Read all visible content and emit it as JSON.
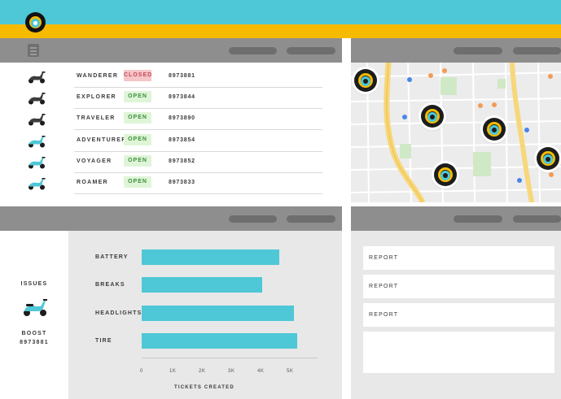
{
  "colors": {
    "brand_teal": "#4ec7d6",
    "brand_yellow": "#f6bb00",
    "open_bg": "#dff5d8",
    "closed_bg": "#f6c5c8"
  },
  "header": {
    "logo_icon": "logo-icon"
  },
  "fleet": {
    "rows": [
      {
        "name": "WANDERER",
        "status": "CLOSED",
        "status_type": "closed",
        "id": "8973881"
      },
      {
        "name": "EXPLORER",
        "status": "OPEN",
        "status_type": "open",
        "id": "8973844"
      },
      {
        "name": "TRAVELER",
        "status": "OPEN",
        "status_type": "open",
        "id": "8973890"
      },
      {
        "name": "ADVENTURER",
        "status": "OPEN",
        "status_type": "open",
        "id": "8973854"
      },
      {
        "name": "VOYAGER",
        "status": "OPEN",
        "status_type": "open",
        "id": "8973852"
      },
      {
        "name": "ROAMER",
        "status": "OPEN",
        "status_type": "open",
        "id": "8973833"
      }
    ]
  },
  "map": {
    "marker_count": 5,
    "markers": "scooter-location-pin"
  },
  "issues": {
    "title": "ISSUES",
    "vehicle_name": "BOOST",
    "vehicle_id": "8973881"
  },
  "chart_data": {
    "type": "bar",
    "orientation": "horizontal",
    "categories": [
      "BATTERY",
      "BREAKS",
      "HEADLIGHTS",
      "TIRE"
    ],
    "values": [
      4700,
      4100,
      5200,
      5300
    ],
    "xlabel": "TICKETS CREATED",
    "xticks": [
      "0",
      "1K",
      "2K",
      "3K",
      "4K",
      "5K"
    ],
    "xlim": [
      0,
      6000
    ],
    "grid": false
  },
  "reports": {
    "items": [
      {
        "label": "REPORT"
      },
      {
        "label": "REPORT"
      },
      {
        "label": "REPORT"
      },
      {
        "label": ""
      }
    ]
  }
}
